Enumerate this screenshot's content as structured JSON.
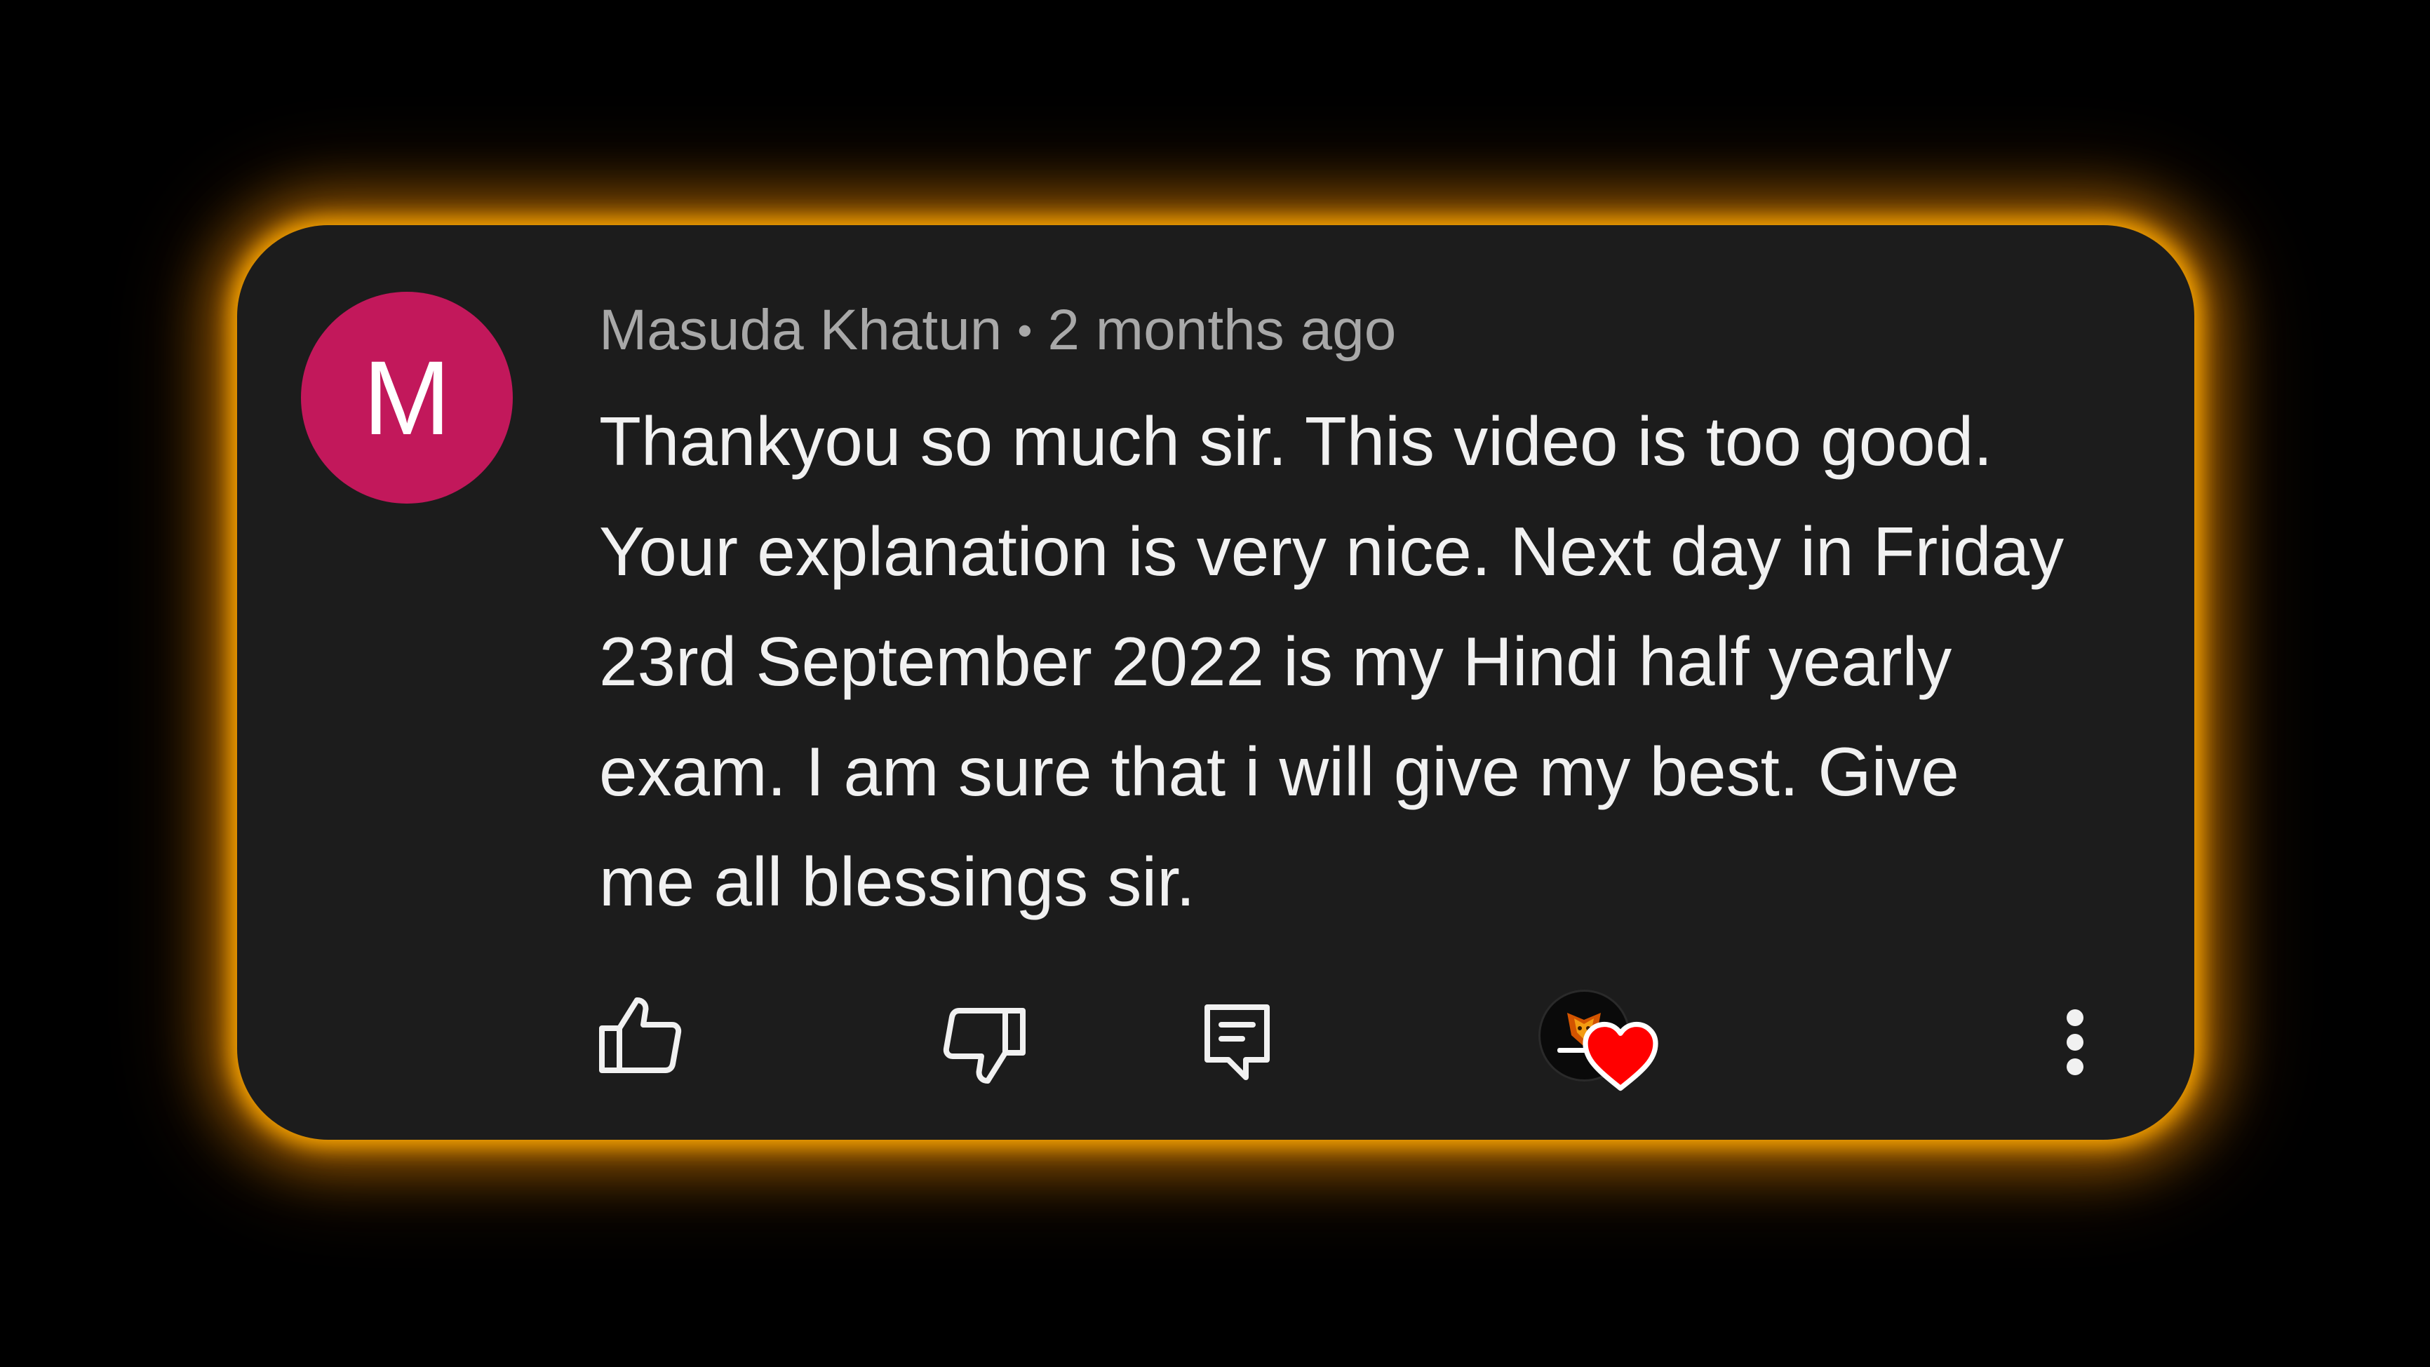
{
  "comment": {
    "avatar_letter": "M",
    "avatar_color": "#c2185b",
    "author": "Masuda Khatun",
    "separator": "•",
    "time_ago": "2 months ago",
    "text": "Thankyou so much sir. This video is too good. Your explanation is very nice. Next day in Friday 23rd September 2022 is my Hindi half yearly exam. I am sure that i will give my best. Give me all blessings sir."
  },
  "actions": {
    "like_icon": "thumbs-up-icon",
    "dislike_icon": "thumbs-down-icon",
    "reply_icon": "reply-comment-icon",
    "creator_heart_icon": "heart-icon",
    "more_icon": "more-vertical-icon"
  },
  "colors": {
    "card_bg": "#1c1c1c",
    "glow": "#ffaa00",
    "heart": "#ff0000",
    "author_text": "#a8a8a8",
    "body_text": "#f1f1f1"
  }
}
